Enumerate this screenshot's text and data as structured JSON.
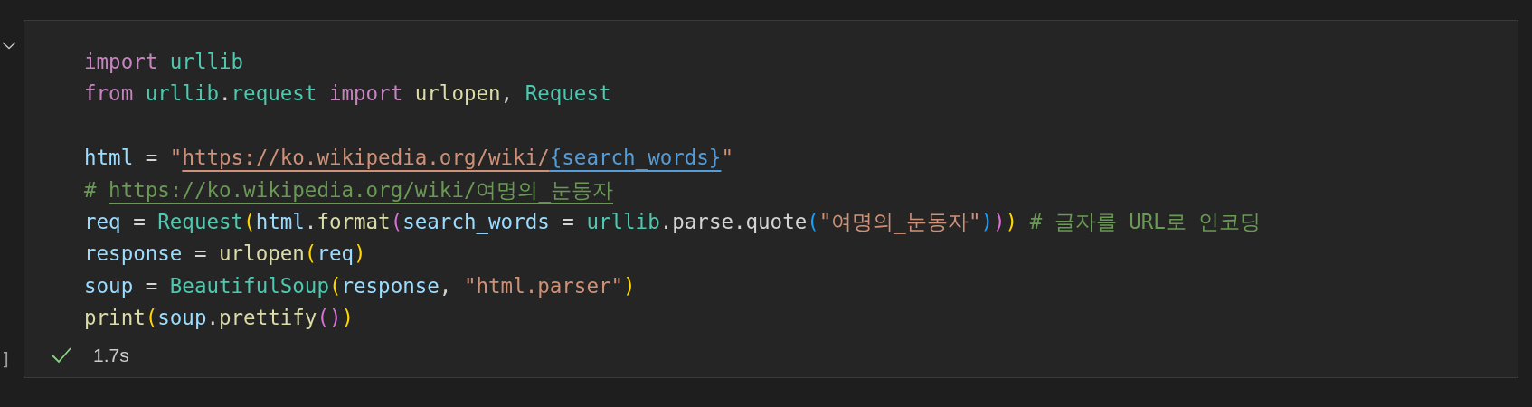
{
  "cell": {
    "collapsed": false,
    "execution_count": "]",
    "status": {
      "success": true,
      "duration": "1.7s"
    },
    "lines": [
      {
        "kind": "code",
        "tokens": [
          {
            "text": "import ",
            "kind": "keyword"
          },
          {
            "text": "urllib",
            "kind": "module"
          }
        ]
      },
      {
        "kind": "code",
        "tokens": [
          {
            "text": "from ",
            "kind": "keyword"
          },
          {
            "text": "urllib",
            "kind": "module"
          },
          {
            "text": ".",
            "kind": "plain"
          },
          {
            "text": "request ",
            "kind": "module"
          },
          {
            "text": "import ",
            "kind": "keyword"
          },
          {
            "text": "urlopen",
            "kind": "function"
          },
          {
            "text": ", ",
            "kind": "plain"
          },
          {
            "text": "Request",
            "kind": "class"
          }
        ]
      },
      {
        "kind": "blank"
      },
      {
        "kind": "code",
        "tokens": [
          {
            "text": "html",
            "kind": "variable"
          },
          {
            "text": " = ",
            "kind": "plain"
          },
          {
            "text": "\"",
            "kind": "string"
          },
          {
            "text": "https://ko.wikipedia.org/wiki/",
            "kind": "string",
            "link": true
          },
          {
            "text": "{search_words}",
            "kind": "format",
            "link": true
          },
          {
            "text": "\"",
            "kind": "string"
          }
        ]
      },
      {
        "kind": "code",
        "tokens": [
          {
            "text": "# ",
            "kind": "comment"
          },
          {
            "text": "https://ko.wikipedia.org/wiki/여명의_눈동자",
            "kind": "comment",
            "link": true
          }
        ]
      },
      {
        "kind": "code",
        "tokens": [
          {
            "text": "req",
            "kind": "variable"
          },
          {
            "text": " = ",
            "kind": "plain"
          },
          {
            "text": "Request",
            "kind": "class"
          },
          {
            "text": "(",
            "kind": "bracket1"
          },
          {
            "text": "html",
            "kind": "variable"
          },
          {
            "text": ".",
            "kind": "plain"
          },
          {
            "text": "format",
            "kind": "function"
          },
          {
            "text": "(",
            "kind": "bracket2"
          },
          {
            "text": "search_words",
            "kind": "variable"
          },
          {
            "text": " = ",
            "kind": "plain"
          },
          {
            "text": "urllib",
            "kind": "module"
          },
          {
            "text": ".parse.quote",
            "kind": "plain"
          },
          {
            "text": "(",
            "kind": "bracket3"
          },
          {
            "text": "\"여명의_눈동자\"",
            "kind": "string"
          },
          {
            "text": ")",
            "kind": "bracket3"
          },
          {
            "text": ")",
            "kind": "bracket2"
          },
          {
            "text": ")",
            "kind": "bracket1"
          },
          {
            "text": " # 글자를 URL로 인코딩",
            "kind": "comment"
          }
        ]
      },
      {
        "kind": "code",
        "tokens": [
          {
            "text": "response",
            "kind": "variable"
          },
          {
            "text": " = ",
            "kind": "plain"
          },
          {
            "text": "urlopen",
            "kind": "function"
          },
          {
            "text": "(",
            "kind": "bracket1"
          },
          {
            "text": "req",
            "kind": "variable"
          },
          {
            "text": ")",
            "kind": "bracket1"
          }
        ]
      },
      {
        "kind": "code",
        "tokens": [
          {
            "text": "soup",
            "kind": "variable"
          },
          {
            "text": " = ",
            "kind": "plain"
          },
          {
            "text": "BeautifulSoup",
            "kind": "class"
          },
          {
            "text": "(",
            "kind": "bracket1"
          },
          {
            "text": "response",
            "kind": "variable"
          },
          {
            "text": ", ",
            "kind": "plain"
          },
          {
            "text": "\"html.parser\"",
            "kind": "string"
          },
          {
            "text": ")",
            "kind": "bracket1"
          }
        ]
      },
      {
        "kind": "code",
        "tokens": [
          {
            "text": "print",
            "kind": "function"
          },
          {
            "text": "(",
            "kind": "bracket1"
          },
          {
            "text": "soup",
            "kind": "variable"
          },
          {
            "text": ".",
            "kind": "plain"
          },
          {
            "text": "prettify",
            "kind": "function"
          },
          {
            "text": "(",
            "kind": "bracket2"
          },
          {
            "text": ")",
            "kind": "bracket2"
          },
          {
            "text": ")",
            "kind": "bracket1"
          }
        ]
      }
    ]
  }
}
